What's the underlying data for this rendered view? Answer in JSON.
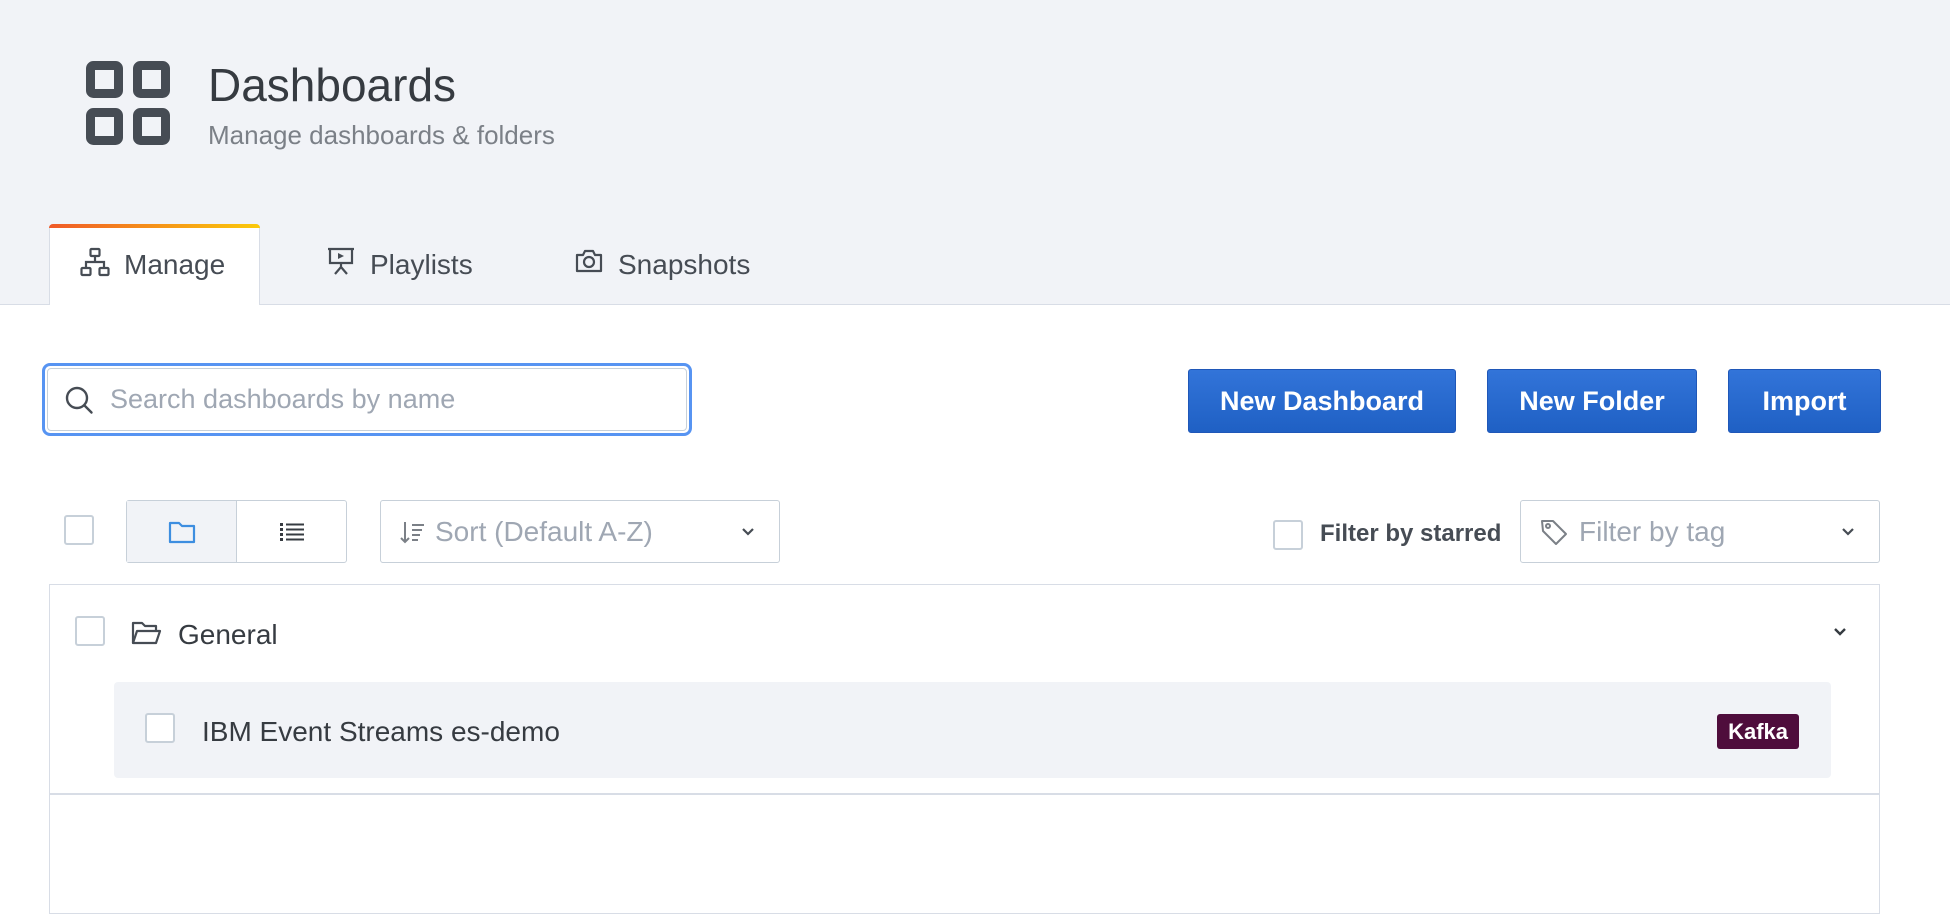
{
  "header": {
    "title": "Dashboards",
    "subtitle": "Manage dashboards & folders",
    "icon": "dashboard-grid-icon"
  },
  "tabs": [
    {
      "label": "Manage",
      "icon": "sitemap-icon",
      "active": true
    },
    {
      "label": "Playlists",
      "icon": "presentation-icon",
      "active": false
    },
    {
      "label": "Snapshots",
      "icon": "camera-icon",
      "active": false
    }
  ],
  "search": {
    "placeholder": "Search dashboards by name",
    "value": ""
  },
  "actions": {
    "new_dashboard": "New Dashboard",
    "new_folder": "New Folder",
    "import": "Import"
  },
  "toolbar": {
    "sort_placeholder": "Sort (Default A-Z)",
    "filter_starred_label": "Filter by starred",
    "filter_tag_placeholder": "Filter by tag",
    "view_mode": "folders"
  },
  "folders": [
    {
      "name": "General",
      "expanded": true,
      "dashboards": [
        {
          "title": "IBM Event Streams es-demo",
          "tags": [
            "Kafka"
          ]
        }
      ]
    }
  ],
  "colors": {
    "primary": "#3274d9",
    "tag_kafka": "#4f0d3c",
    "focus": "#5794f2",
    "header_bg": "#f1f3f7"
  }
}
